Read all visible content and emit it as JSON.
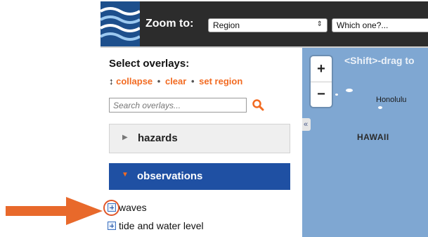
{
  "header": {
    "zoom_label": "Zoom to:",
    "region_select": "Region",
    "which_select": "Which one?..."
  },
  "sidebar": {
    "title": "Select overlays:",
    "actions": {
      "arrows": "↕",
      "collapse": "collapse",
      "clear": "clear",
      "set_region": "set region",
      "separator": "•"
    },
    "search_placeholder": "Search overlays...",
    "sections": [
      {
        "label": "hazards",
        "expanded": false
      },
      {
        "label": "observations",
        "expanded": true
      }
    ],
    "items": [
      {
        "label": "waves"
      },
      {
        "label": "tide and water level"
      }
    ]
  },
  "map": {
    "drag_hint": "<Shift>-drag to",
    "zoom_in": "+",
    "zoom_out": "−",
    "collapse_tab": "«",
    "labels": {
      "honolulu": "Honolulu",
      "hawaii": "HAWAII"
    }
  },
  "colors": {
    "accent": "#f26b22",
    "section_active": "#1f50a3",
    "map_water": "#7fa7d2",
    "top_bar": "#2c2c2c"
  }
}
